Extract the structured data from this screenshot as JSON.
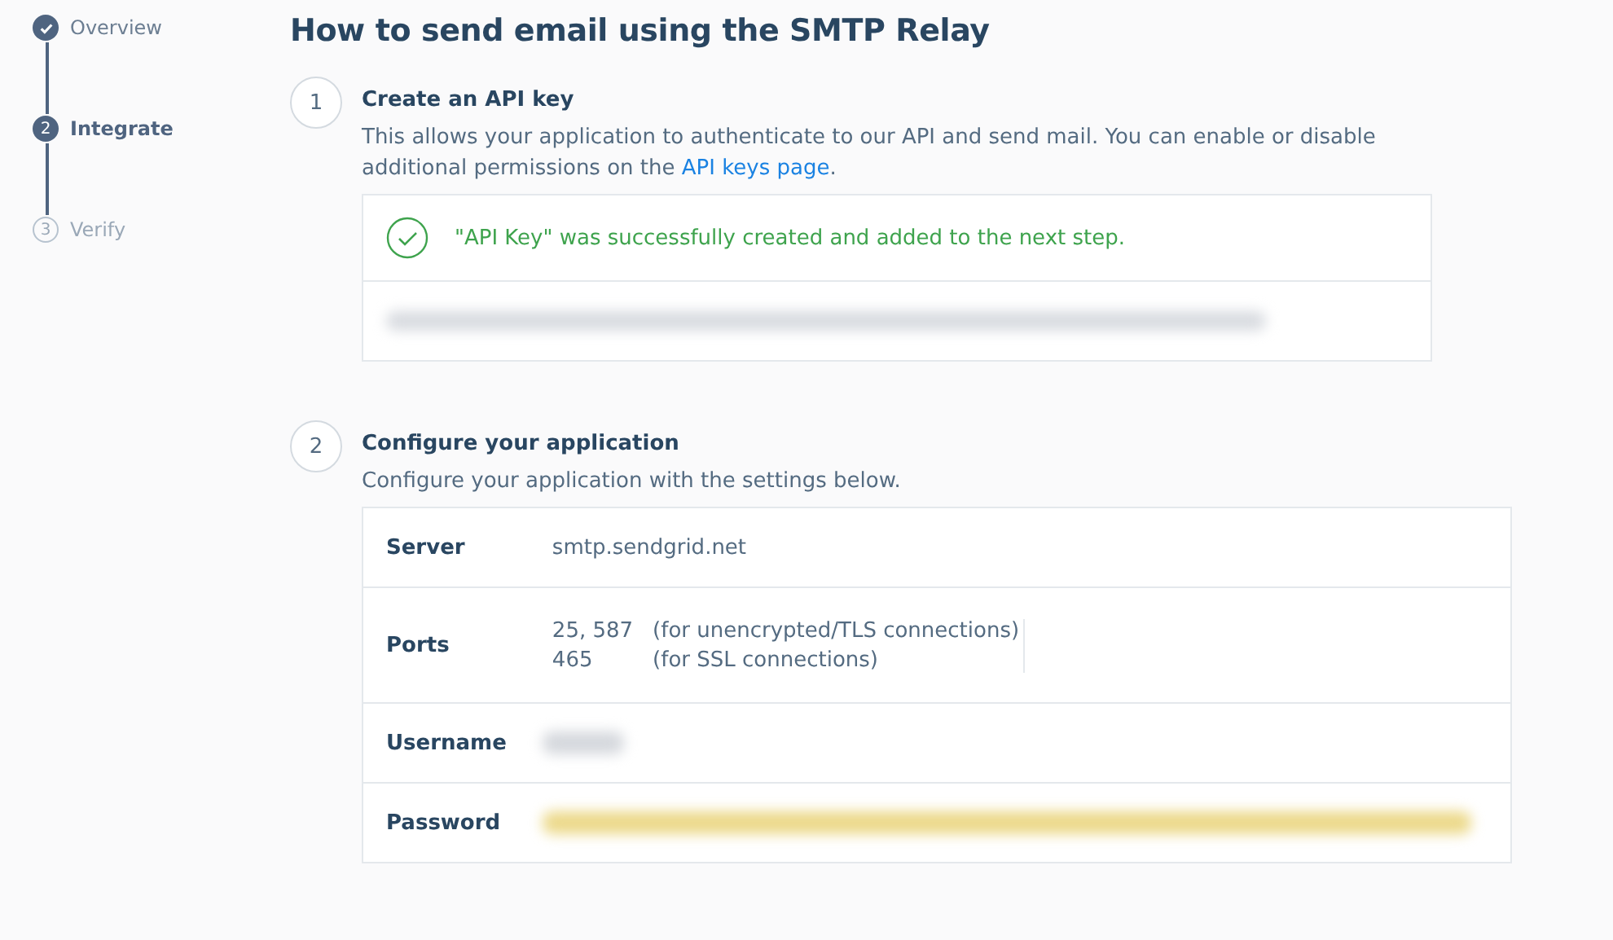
{
  "progress_steps": [
    {
      "label": "Overview",
      "completed": true,
      "selected": false
    },
    {
      "label": "Integrate",
      "completed": false,
      "selected": true,
      "marker": "2"
    },
    {
      "label": "Verify",
      "completed": false,
      "selected": false,
      "marker": "3"
    }
  ],
  "title": "How to send email using the SMTP Relay",
  "sections": [
    {
      "number": "1",
      "heading": "Create an API key",
      "description": "This allows your application to authenticate to our API and send mail. You can enable or disable additional permissions on the ",
      "link": "API keys page",
      "description_end": ".",
      "success_message": "\"API Key\" was successfully created and added to the next step.",
      "key_redacted": true
    },
    {
      "number": "2",
      "heading": "Configure your application",
      "description": "Configure your application with the settings below.",
      "settings": [
        {
          "kind": "text",
          "label": "Server",
          "value": "smtp.sendgrid.net"
        },
        {
          "kind": "ports",
          "label": "Ports",
          "ports": [
            {
              "port": "25, 587",
              "note": "(for unencrypted/TLS connections)"
            },
            {
              "port": "465",
              "note": "(for SSL connections)"
            }
          ]
        },
        {
          "kind": "redacted",
          "label": "Username",
          "color": "#d5d8dd"
        },
        {
          "kind": "redacted",
          "label": "Password",
          "color": "#ecd98a"
        }
      ]
    }
  ]
}
